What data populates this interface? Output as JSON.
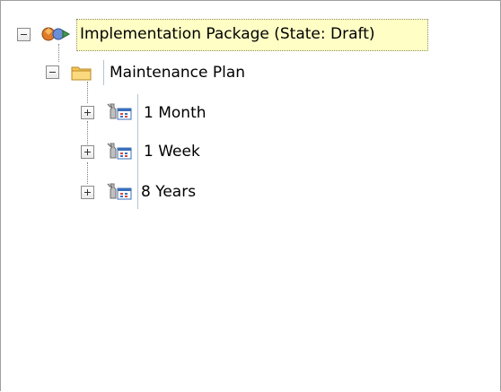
{
  "tree": {
    "root": {
      "label": "Implementation Package (State: Draft)",
      "icon": "implementation-package-icon",
      "expanded": true,
      "children": [
        {
          "label": "Maintenance Plan",
          "icon": "folder-icon",
          "expanded": true,
          "children": [
            {
              "label": "1 Month",
              "icon": "maintenance-task-icon",
              "expanded": false
            },
            {
              "label": "1 Week",
              "icon": "maintenance-task-icon",
              "expanded": false
            },
            {
              "label": "8 Years",
              "icon": "maintenance-task-icon",
              "expanded": false
            }
          ]
        }
      ]
    }
  }
}
